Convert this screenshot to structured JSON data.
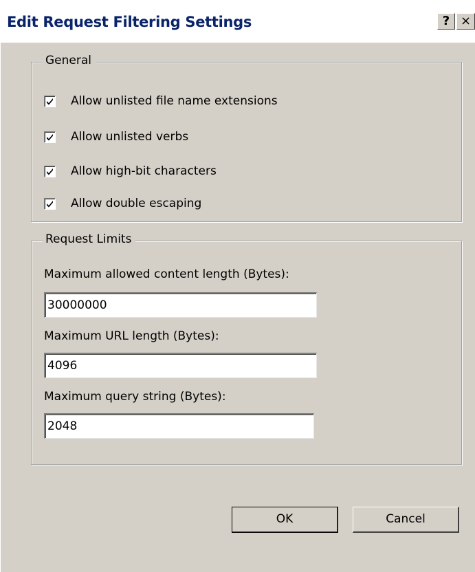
{
  "window": {
    "title": "Edit Request Filtering Settings",
    "help_label": "?",
    "close_label": "×"
  },
  "general": {
    "legend": "General",
    "options": [
      {
        "label": "Allow unlisted file name extensions",
        "checked": true
      },
      {
        "label": "Allow unlisted verbs",
        "checked": true
      },
      {
        "label": "Allow high-bit characters",
        "checked": true
      },
      {
        "label": "Allow double escaping",
        "checked": true
      }
    ]
  },
  "limits": {
    "legend": "Request Limits",
    "max_content_length": {
      "label": "Maximum allowed content length (Bytes):",
      "value": "30000000"
    },
    "max_url_length": {
      "label": "Maximum URL length (Bytes):",
      "value": "4096"
    },
    "max_query_string": {
      "label": "Maximum query string (Bytes):",
      "value": "2048"
    }
  },
  "buttons": {
    "ok_label": "OK",
    "cancel_label": "Cancel"
  },
  "colors": {
    "dialog_face": "#d4d0c8",
    "title_text": "#0a246a"
  }
}
